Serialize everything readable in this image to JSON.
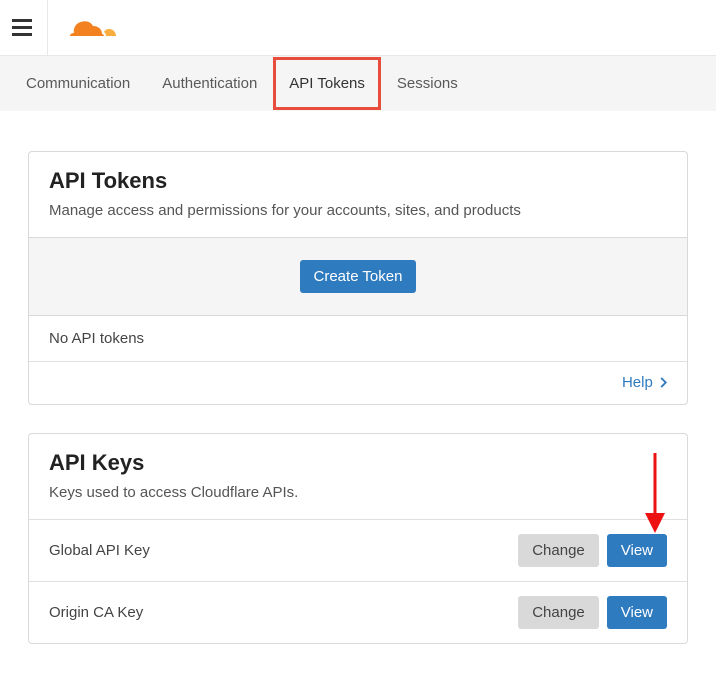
{
  "tabs": [
    {
      "label": "Communication",
      "active": false
    },
    {
      "label": "Authentication",
      "active": false
    },
    {
      "label": "API Tokens",
      "active": true
    },
    {
      "label": "Sessions",
      "active": false
    }
  ],
  "tokens_panel": {
    "title": "API Tokens",
    "subtitle": "Manage access and permissions for your accounts, sites, and products",
    "create_label": "Create Token",
    "empty_text": "No API tokens",
    "help_label": "Help"
  },
  "keys_panel": {
    "title": "API Keys",
    "subtitle": "Keys used to access Cloudflare APIs.",
    "rows": [
      {
        "name": "Global API Key",
        "change_label": "Change",
        "view_label": "View"
      },
      {
        "name": "Origin CA Key",
        "change_label": "Change",
        "view_label": "View"
      }
    ]
  },
  "colors": {
    "primary": "#2f7bbf",
    "highlight_border": "#e74c3c",
    "logo_orange": "#f48120",
    "logo_light": "#faad3f"
  }
}
